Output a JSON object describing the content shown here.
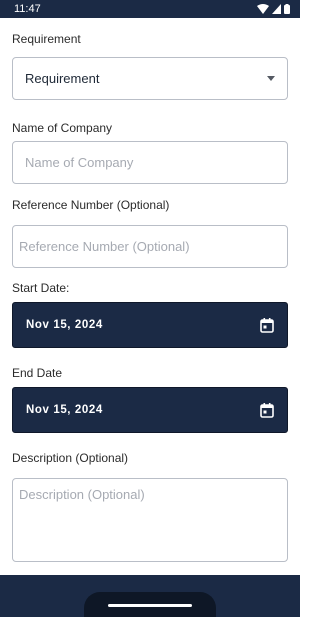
{
  "status_bar": {
    "time": "11:47"
  },
  "form": {
    "requirement": {
      "label": "Requirement",
      "value": "Requirement"
    },
    "company": {
      "label": "Name of Company",
      "placeholder": "Name of Company"
    },
    "reference": {
      "label": "Reference Number (Optional)",
      "placeholder": "Reference Number (Optional)"
    },
    "start_date": {
      "label": "Start Date:",
      "value": "Nov 15, 2024"
    },
    "end_date": {
      "label": "End Date",
      "value": "Nov 15, 2024"
    },
    "description": {
      "label": "Description (Optional)",
      "placeholder": "Description (Optional)"
    }
  },
  "colors": {
    "primary_navy": "#1b2a45",
    "field_border": "#b9bec7",
    "placeholder": "#a6aab2"
  },
  "icons": {
    "dropdown": "chevron-down-icon",
    "date": "calendar-icon",
    "wifi": "wifi-icon",
    "signal": "signal-icon",
    "battery": "battery-icon"
  }
}
